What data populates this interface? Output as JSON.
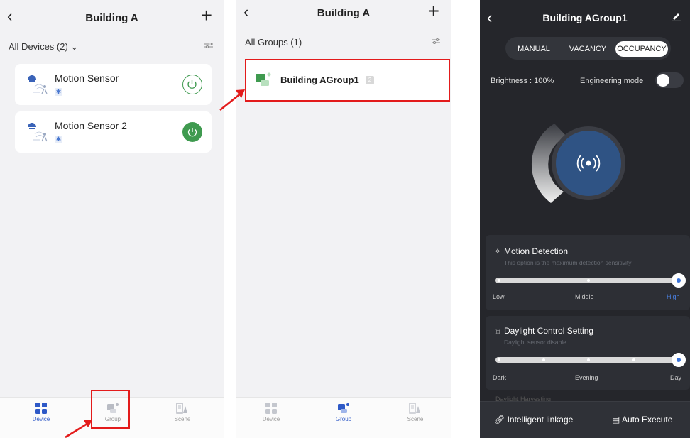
{
  "screen1": {
    "header": {
      "back_glyph": "‹",
      "title": "Building A",
      "add_glyph": "+"
    },
    "list_header": {
      "label": "All Devices (2) ⌄",
      "filter_icon": "filter-icon"
    },
    "devices": [
      {
        "name": "Motion Sensor",
        "power_state": "off"
      },
      {
        "name": "Motion Sensor 2",
        "power_state": "on"
      }
    ],
    "tabs": [
      {
        "label": "Device",
        "active": true
      },
      {
        "label": "Group",
        "active": false
      },
      {
        "label": "Scene",
        "active": false
      }
    ]
  },
  "screen2": {
    "header": {
      "back_glyph": "‹",
      "title": "Building A",
      "add_glyph": "+"
    },
    "list_header": {
      "label": "All Groups (1)"
    },
    "groups": [
      {
        "name": "Building AGroup1",
        "count": "2"
      }
    ],
    "tabs": [
      {
        "label": "Device",
        "active": false
      },
      {
        "label": "Group",
        "active": true
      },
      {
        "label": "Scene",
        "active": false
      }
    ]
  },
  "screen3": {
    "header": {
      "back_glyph": "‹",
      "title": "Building AGroup1"
    },
    "modes": [
      {
        "label": "MANUAL",
        "selected": false
      },
      {
        "label": "VACANCY",
        "selected": false
      },
      {
        "label": "OCCUPANCY",
        "selected": true
      }
    ],
    "brightness": "Brightness : 100%",
    "engineering_mode": {
      "label": "Engineering mode",
      "on": false
    },
    "motion": {
      "title": "Motion Detection",
      "subtitle": "This option is the maximum detection sensitivity",
      "labels": [
        "Low",
        "Middle",
        "High"
      ],
      "value_index": 2
    },
    "daylight": {
      "title": "Daylight Control Setting",
      "subtitle": "Daylight sensor disable",
      "labels": [
        "Dark",
        "Evening",
        "Day"
      ],
      "value_index": 4
    },
    "harvesting_label": "Daylight Harvesting",
    "bottom": {
      "linkage": "Intelligent linkage",
      "execute": "Auto Execute"
    }
  },
  "colors": {
    "accent_green": "#3f9a4f",
    "accent_blue": "#2e59c7",
    "highlight_red": "#e31b1b",
    "dark_bg": "#25262b"
  }
}
